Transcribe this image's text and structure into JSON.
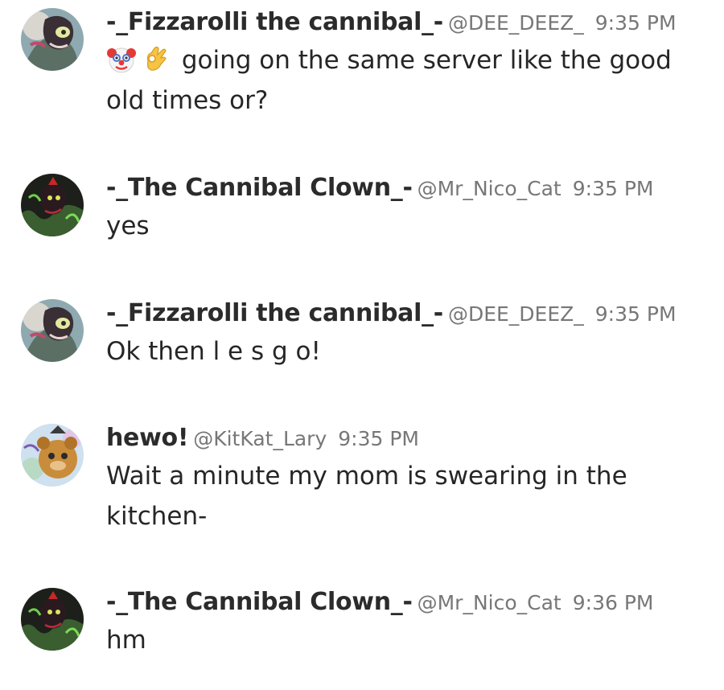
{
  "messages": [
    {
      "author": "-_Fizzarolli the cannibal_-",
      "handle": "@DEE_DEEZ_",
      "time": "9:35 PM",
      "avatar_icon": "fizzarolli-avatar",
      "emojis": [
        "clown-face-emoji",
        "ok-hand-emoji"
      ],
      "text": "going on the same server like the good old times or?"
    },
    {
      "author": "-_The Cannibal Clown_-",
      "handle": "@Mr_Nico_Cat",
      "time": "9:35 PM",
      "avatar_icon": "cannibal-clown-avatar",
      "text": "yes"
    },
    {
      "author": "-_Fizzarolli the cannibal_-",
      "handle": "@DEE_DEEZ_",
      "time": "9:35 PM",
      "avatar_icon": "fizzarolli-avatar",
      "text": "Ok then l e s g o!"
    },
    {
      "author": "hewo!",
      "handle": "@KitKat_Lary",
      "time": "9:35 PM",
      "avatar_icon": "animatronic-bear-avatar",
      "text": "Wait a minute my mom is swearing in the kitchen-"
    },
    {
      "author": "-_The Cannibal Clown_-",
      "handle": "@Mr_Nico_Cat",
      "time": "9:36 PM",
      "avatar_icon": "cannibal-clown-avatar",
      "text": "hm"
    }
  ]
}
